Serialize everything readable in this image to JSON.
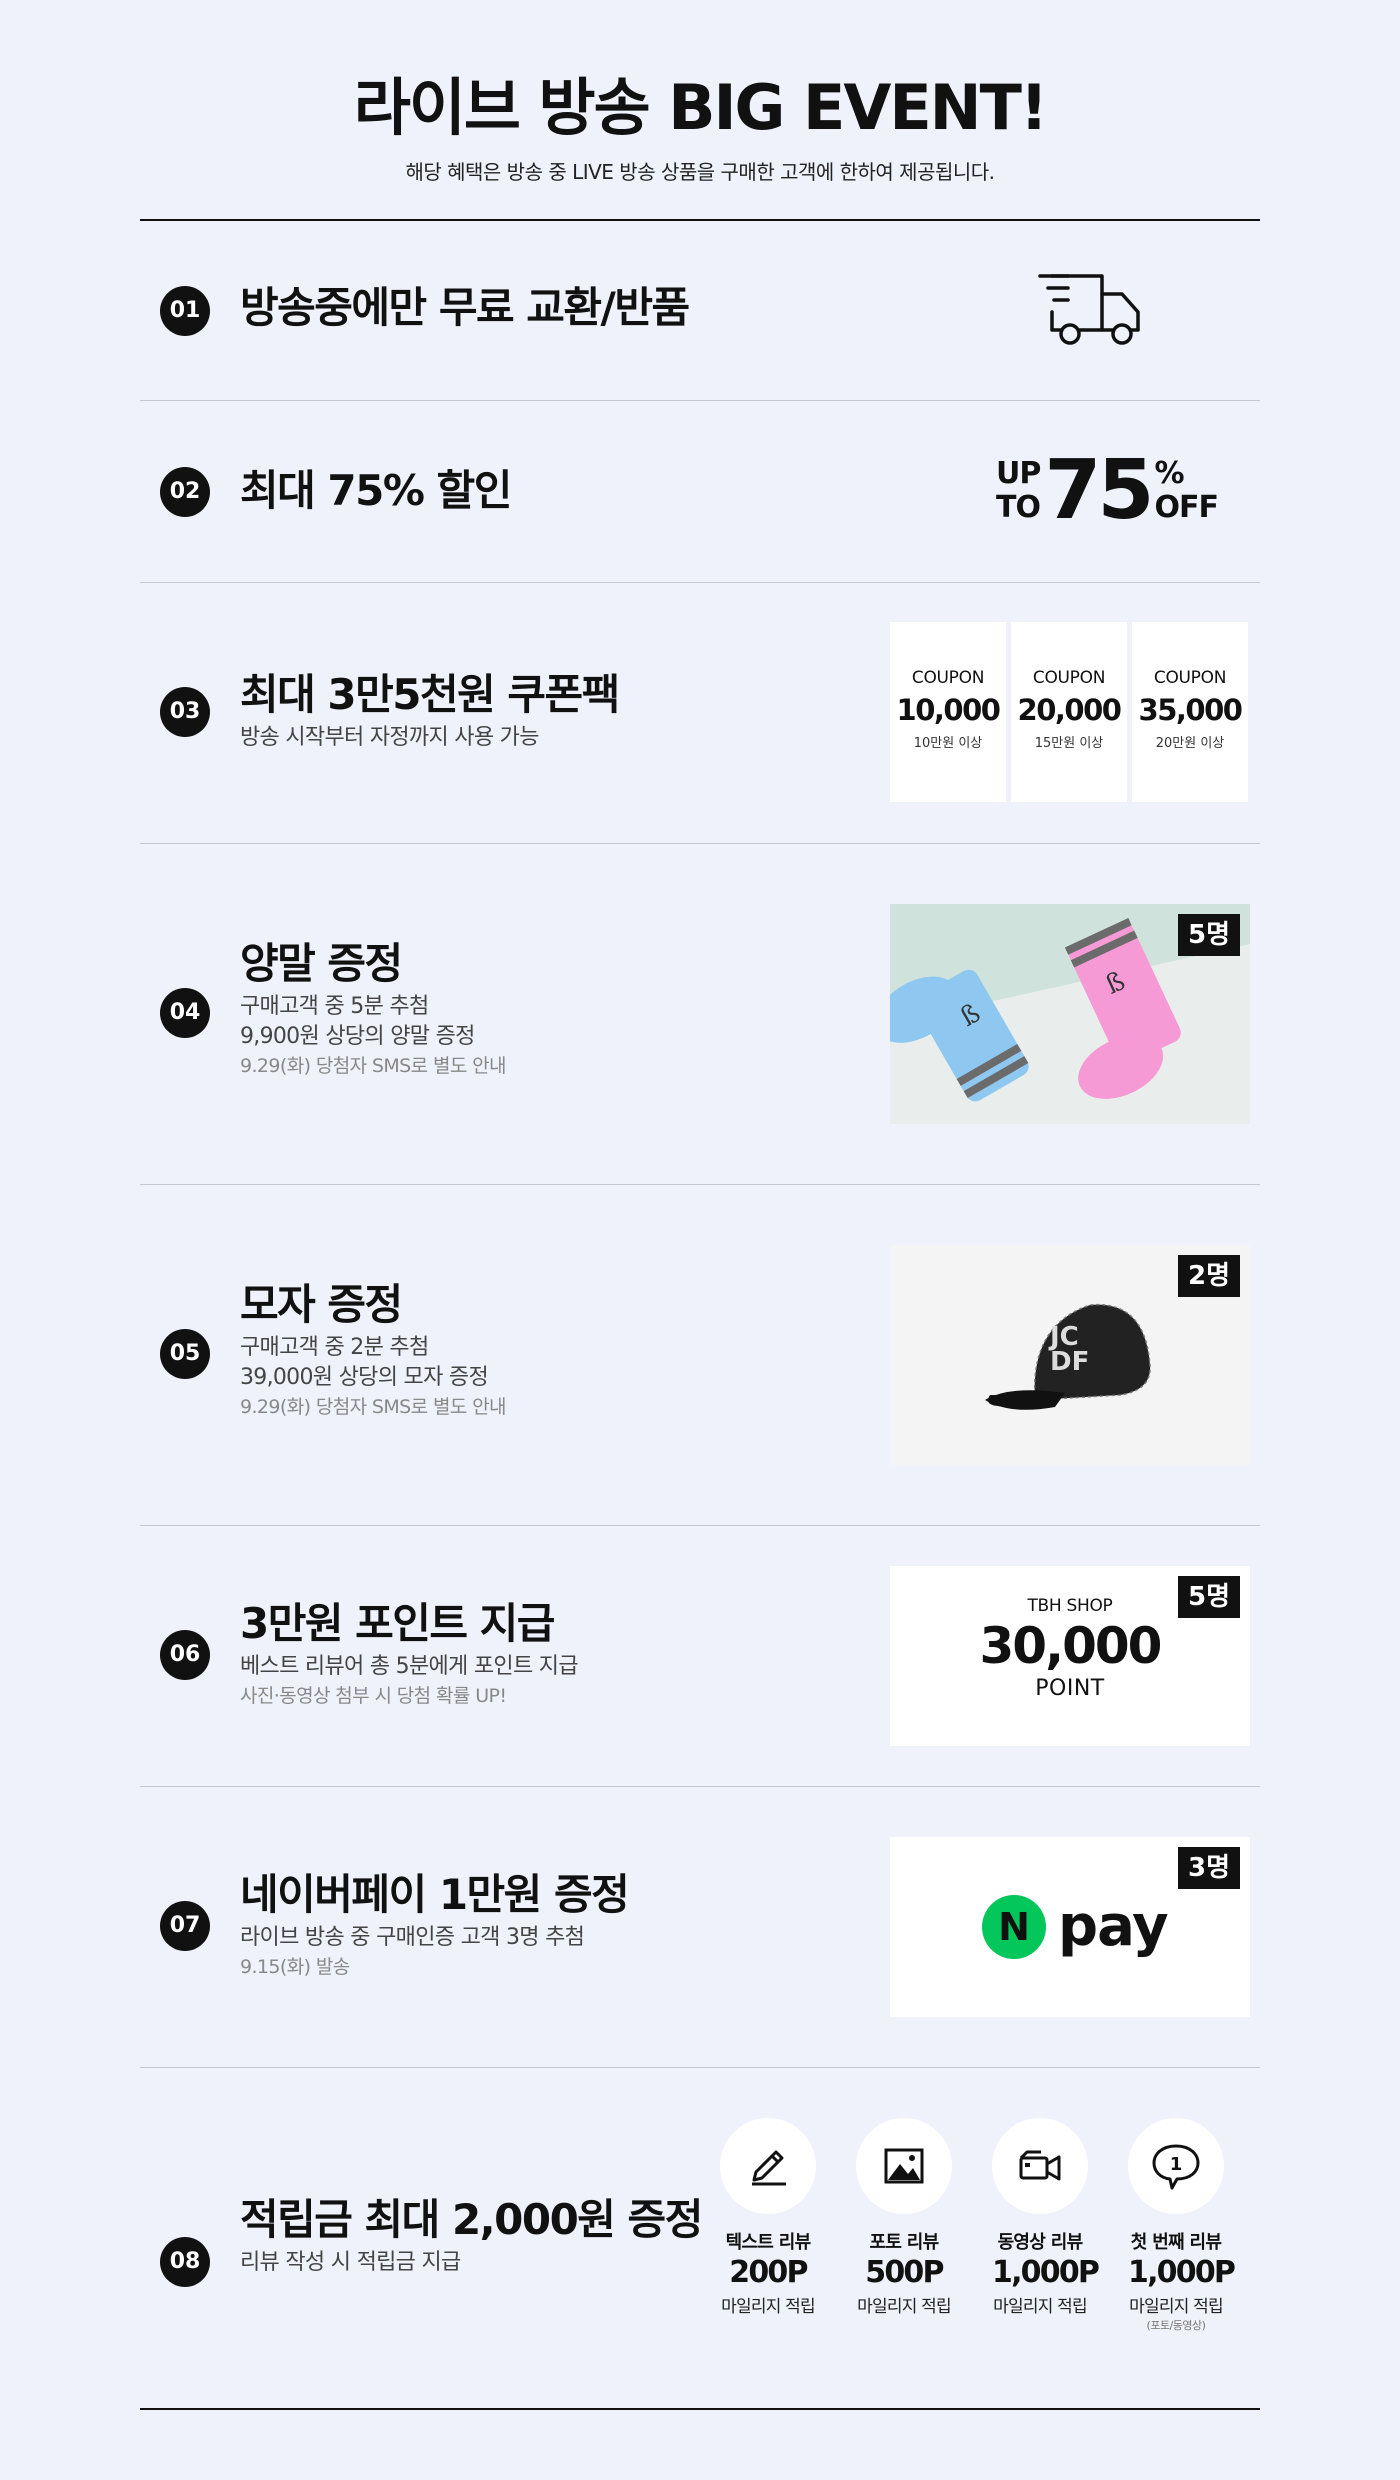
{
  "header": {
    "title": "라이브 방송 BIG EVENT!",
    "subtitle": "해당 혜택은 방송 중 LIVE 방송 상품을 구매한 고객에 한하여 제공됩니다."
  },
  "events": [
    {
      "num": "01",
      "title": "방송중에만 무료 교환/반품",
      "icon": "delivery-truck-icon"
    },
    {
      "num": "02",
      "title": "최대 75% 할인",
      "badge": {
        "up": "UP",
        "to": "TO",
        "value": "75",
        "pct": "%",
        "off": "OFF"
      }
    },
    {
      "num": "03",
      "title": "최대 3만5천원 쿠폰팩",
      "desc": "방송 시작부터 자정까지 사용 가능",
      "coupons": [
        {
          "label": "COUPON",
          "amount": "10,000",
          "cond": "10만원 이상"
        },
        {
          "label": "COUPON",
          "amount": "20,000",
          "cond": "15만원 이상"
        },
        {
          "label": "COUPON",
          "amount": "35,000",
          "cond": "20만원 이상"
        }
      ]
    },
    {
      "num": "04",
      "title": "양말 증정",
      "desc1": "구매고객 중 5분 추첨",
      "desc2": "9,900원 상당의 양말 증정",
      "note": "9.29(화) 당첨자 SMS로 별도 안내",
      "count": "5명"
    },
    {
      "num": "05",
      "title": "모자 증정",
      "desc1": "구매고객 중 2분 추첨",
      "desc2": "39,000원 상당의 모자 증정",
      "note": "9.29(화) 당첨자 SMS로 별도 안내",
      "count": "2명"
    },
    {
      "num": "06",
      "title": "3만원 포인트 지급",
      "desc": "베스트 리뷰어 총 5분에게 포인트 지급",
      "note": "사진·동영상 첨부 시 당첨 확률 UP!",
      "count": "5명",
      "card": {
        "shop": "TBH SHOP",
        "value": "30,000",
        "unit": "POINT"
      }
    },
    {
      "num": "07",
      "title": "네이버페이 1만원 증정",
      "desc": "라이브 방송 중 구매인증 고객 3명 추첨",
      "note": "9.15(화) 발송",
      "count": "3명",
      "pay": {
        "n": "N",
        "text": "pay",
        "color": "#03c75a"
      }
    },
    {
      "num": "08",
      "title": "적립금 최대 2,000원 증정",
      "desc": "리뷰 작성 시 적립금 지급",
      "reviews": [
        {
          "icon": "pencil-icon",
          "label": "텍스트 리뷰",
          "points": "200P",
          "sub": "마일리지 적립"
        },
        {
          "icon": "image-icon",
          "label": "포토 리뷰",
          "points": "500P",
          "sub": "마일리지 적립"
        },
        {
          "icon": "video-camera-icon",
          "label": "동영상 리뷰",
          "points": "1,000P",
          "sub": "마일리지 적립"
        },
        {
          "icon": "speech-bubble-icon",
          "label": "첫 번째 리뷰",
          "points": "1,000P",
          "sub": "마일리지 적립",
          "note": "(포토/동영상)",
          "bubble": "1"
        }
      ]
    }
  ]
}
